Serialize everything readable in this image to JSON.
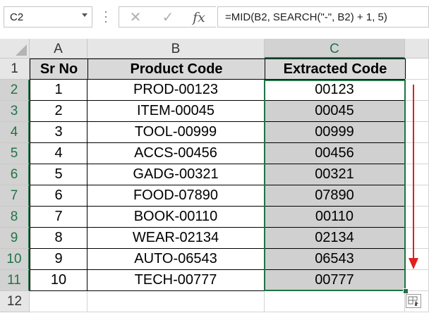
{
  "formula_bar": {
    "name_box": "C2",
    "cancel_icon": "close-icon",
    "enter_icon": "check-icon",
    "fx_label": "fx",
    "formula": "=MID(B2, SEARCH(\"-\", B2) + 1, 5)"
  },
  "columns": [
    "A",
    "B",
    "C"
  ],
  "row_numbers": [
    "1",
    "2",
    "3",
    "4",
    "5",
    "6",
    "7",
    "8",
    "9",
    "10",
    "11",
    "12"
  ],
  "table": {
    "headers": [
      "Sr No",
      "Product Code",
      "Extracted Code"
    ],
    "rows": [
      [
        "1",
        "PROD-00123",
        "00123"
      ],
      [
        "2",
        "ITEM-00045",
        "00045"
      ],
      [
        "3",
        "TOOL-00999",
        "00999"
      ],
      [
        "4",
        "ACCS-00456",
        "00456"
      ],
      [
        "5",
        "GADG-00321",
        "00321"
      ],
      [
        "6",
        "FOOD-07890",
        "07890"
      ],
      [
        "7",
        "BOOK-00110",
        "00110"
      ],
      [
        "8",
        "WEAR-02134",
        "02134"
      ],
      [
        "9",
        "AUTO-06543",
        "06543"
      ],
      [
        "10",
        "TECH-00777",
        "00777"
      ]
    ]
  },
  "selected_column": "C",
  "active_cell": "C2",
  "colors": {
    "selection": "#217346",
    "header_fill": "#d9d9d9",
    "range_fill": "#d0d0d0",
    "arrow": "#e02020"
  },
  "quick_analysis_icon": "quick-analysis-icon",
  "fill_arrow_icon": "down-arrow-icon"
}
